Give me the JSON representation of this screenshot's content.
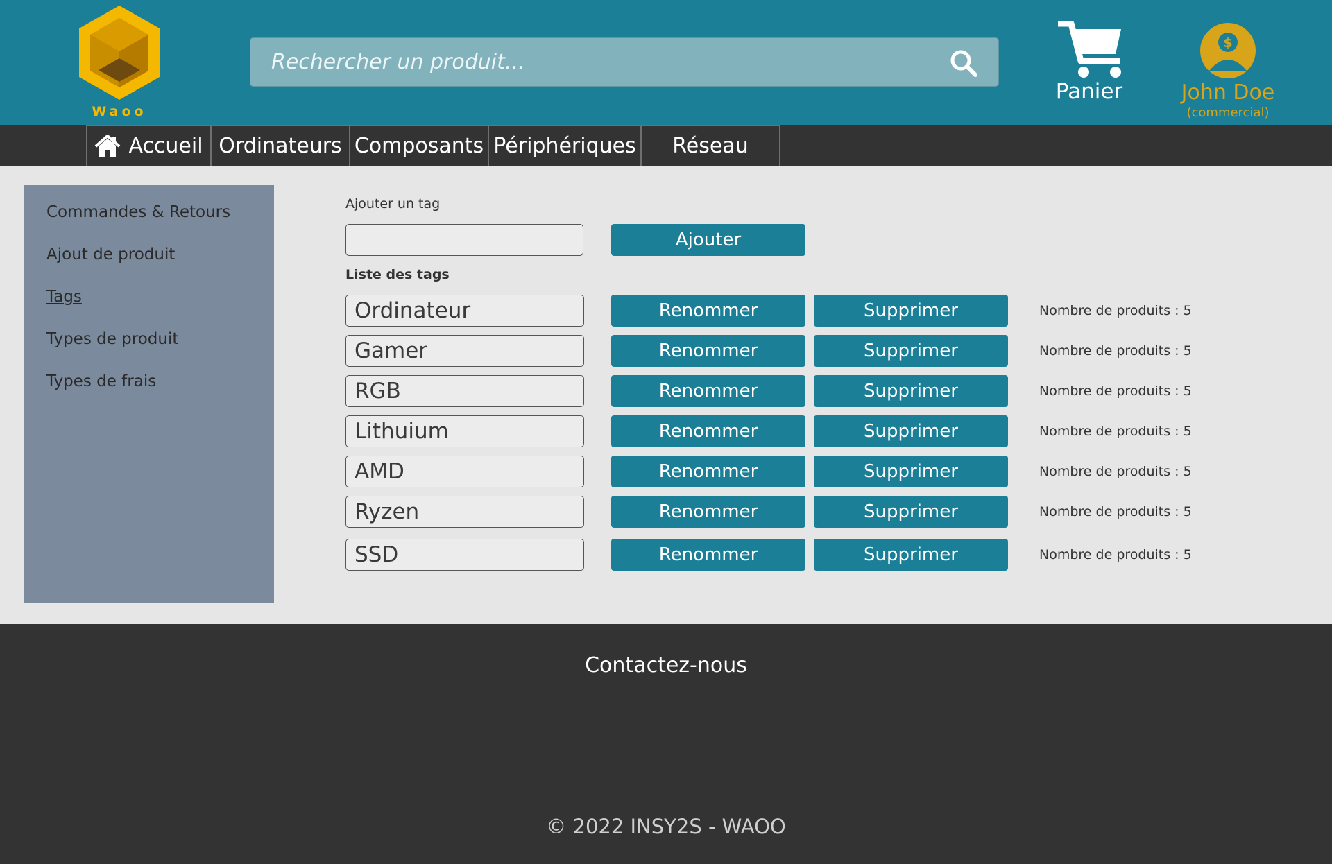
{
  "header": {
    "logo_text": "Waoo",
    "search_placeholder": "Rechercher un produit...",
    "cart_label": "Panier",
    "user_name": "John Doe",
    "user_role": "(commercial)"
  },
  "nav": {
    "items": [
      "Accueil",
      "Ordinateurs",
      "Composants",
      "Périphériques",
      "Réseau"
    ]
  },
  "sidebar": {
    "items": [
      "Commandes & Retours",
      "Ajout de produit",
      "Tags",
      "Types de produit",
      "Types de frais"
    ],
    "active": "Tags"
  },
  "main": {
    "add_label": "Ajouter un tag",
    "add_value": "",
    "add_button": "Ajouter",
    "list_label": "Liste des tags",
    "rename_button": "Renommer",
    "delete_button": "Supprimer",
    "tags": [
      {
        "name": "Ordinateur",
        "count": "Nombre de produits : 5"
      },
      {
        "name": "Gamer",
        "count": "Nombre de produits : 5"
      },
      {
        "name": "RGB",
        "count": "Nombre de produits : 5"
      },
      {
        "name": "Lithuium",
        "count": "Nombre de produits : 5"
      },
      {
        "name": "AMD",
        "count": "Nombre de produits : 5"
      },
      {
        "name": "Ryzen",
        "count": "Nombre de produits : 5"
      },
      {
        "name": "SSD",
        "count": "Nombre de produits : 5"
      }
    ]
  },
  "footer": {
    "contact": "Contactez-nous",
    "copyright": "© 2022 INSY2S - WAOO"
  },
  "colors": {
    "header_bg": "#1a7f97",
    "nav_bg": "#333333",
    "sidebar_bg": "#7b8a9c",
    "button_bg": "#1a7f97",
    "logo_gold": "#f5b800",
    "user_gold": "#d7a41a",
    "page_bg": "#e6e6e6"
  },
  "icons": [
    "logo-icon",
    "search-icon",
    "cart-icon",
    "user-icon",
    "home-icon"
  ]
}
